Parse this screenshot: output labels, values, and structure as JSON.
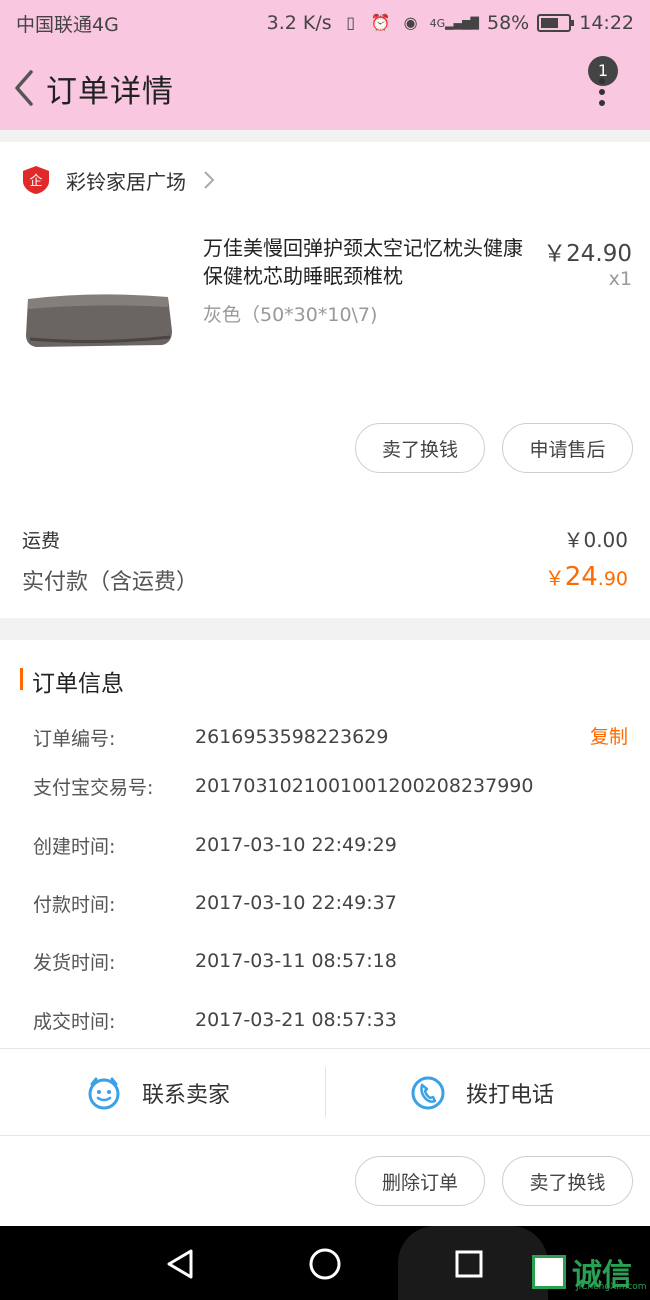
{
  "status_bar": {
    "carrier": "中国联通4G",
    "speed": "3.2 K/s",
    "network": "4G",
    "battery": "58%",
    "time": "14:22"
  },
  "header": {
    "title": "订单详情",
    "badge_count": "1"
  },
  "shop": {
    "name": "彩铃家居广场",
    "logo_text": "企"
  },
  "product": {
    "title": "万佳美慢回弹护颈太空记忆枕头健康保健枕芯助睡眠颈椎枕",
    "variant": "灰色（50*30*10\\7)",
    "price": "￥24.90",
    "quantity": "x1"
  },
  "actions": {
    "sell_exchange": "卖了换钱",
    "after_sale": "申请售后"
  },
  "summary": {
    "shipping_label": "运费",
    "shipping_value": "￥0.00",
    "paid_label": "实付款（含运费）",
    "paid_yen": "￥",
    "paid_int": "24",
    "paid_dec": ".90"
  },
  "order_info": {
    "title": "订单信息",
    "copy_label": "复制",
    "rows": [
      {
        "label": "订单编号:",
        "value": "2616953598223629"
      },
      {
        "label": "支付宝交易号:",
        "value": "2017031021001001200208237990"
      },
      {
        "label": "创建时间:",
        "value": "2017-03-10 22:49:29"
      },
      {
        "label": "付款时间:",
        "value": "2017-03-10 22:49:37"
      },
      {
        "label": "发货时间:",
        "value": "2017-03-11 08:57:18"
      },
      {
        "label": "成交时间:",
        "value": "2017-03-21 08:57:33"
      }
    ]
  },
  "contact": {
    "seller": "联系卖家",
    "call": "拨打电话"
  },
  "bottom_actions": {
    "delete_order": "删除订单",
    "sell_exchange": "卖了换钱"
  },
  "watermark": {
    "text": "诚信",
    "sub": "JiChengXin.com"
  },
  "colors": {
    "header_bg": "#f9c7e0",
    "accent": "#ff6a00",
    "icon_blue": "#3aa0e8"
  }
}
